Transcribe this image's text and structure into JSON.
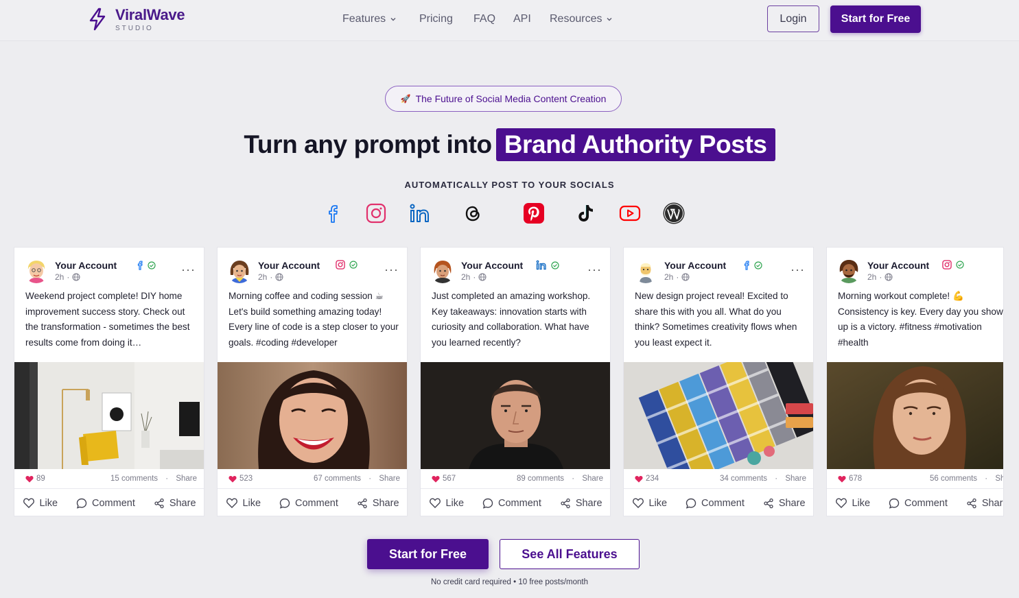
{
  "brand": {
    "name": "ViralWave",
    "subtitle": "STUDIO",
    "color": "#4b0f8f"
  },
  "nav": {
    "items": [
      {
        "label": "Features",
        "dropdown": true
      },
      {
        "label": "Pricing",
        "dropdown": false
      },
      {
        "label": "FAQ",
        "dropdown": false
      },
      {
        "label": "API",
        "dropdown": false
      },
      {
        "label": "Resources",
        "dropdown": true
      }
    ],
    "login_label": "Login",
    "start_label": "Start for Free"
  },
  "hero": {
    "pill_text": "The Future of Social Media Content Creation",
    "pill_icon": "rocket",
    "headline_prefix": "Turn any prompt into",
    "headline_highlight": "Brand Authority Posts",
    "socials_label": "AUTOMATICALLY POST TO YOUR SOCIALS",
    "socials": [
      "facebook-icon",
      "instagram-icon",
      "linkedin-icon",
      "threads-icon",
      "pinterest-icon",
      "tiktok-icon",
      "youtube-icon",
      "wordpress-icon"
    ]
  },
  "cards": [
    {
      "account": "Your Account",
      "platform": "facebook-icon",
      "time": "2h",
      "text": "Weekend project complete! DIY home improvement success story. Check out the transformation - sometimes the best results come from doing it…",
      "likes": "89",
      "comments": "15 comments",
      "share_stat": "Share",
      "image": "living-room-yellow-chair"
    },
    {
      "account": "Your Account",
      "platform": "instagram-icon",
      "time": "2h",
      "text": "Morning coffee and coding session ☕ Let's build something amazing today! Every line of code is a step closer to your goals. #coding #developer",
      "likes": "523",
      "comments": "67 comments",
      "share_stat": "Share",
      "image": "smiling-woman"
    },
    {
      "account": "Your Account",
      "platform": "linkedin-icon",
      "time": "2h",
      "text": "Just completed an amazing workshop. Key takeaways: innovation starts with curiosity and collaboration. What have you learned recently?",
      "likes": "567",
      "comments": "89 comments",
      "share_stat": "Share",
      "image": "man-portrait"
    },
    {
      "account": "Your Account",
      "platform": "facebook-icon",
      "time": "2h",
      "text": "New design project reveal! Excited to share this with you all. What do you think? Sometimes creativity flows when you least expect it.",
      "likes": "234",
      "comments": "34 comments",
      "share_stat": "Share",
      "image": "color-swatches"
    },
    {
      "account": "Your Account",
      "platform": "instagram-icon",
      "time": "2h",
      "text": "Morning workout complete! 💪 Consistency is key. Every day you show up is a victory. #fitness #motivation #health",
      "likes": "678",
      "comments": "56 comments",
      "share_stat": "Share",
      "image": "woman-portrait"
    }
  ],
  "card_actions": {
    "like": "Like",
    "comment": "Comment",
    "share": "Share"
  },
  "cta": {
    "primary": "Start for Free",
    "secondary": "See All Features",
    "note": "No credit card required • 10 free posts/month"
  }
}
